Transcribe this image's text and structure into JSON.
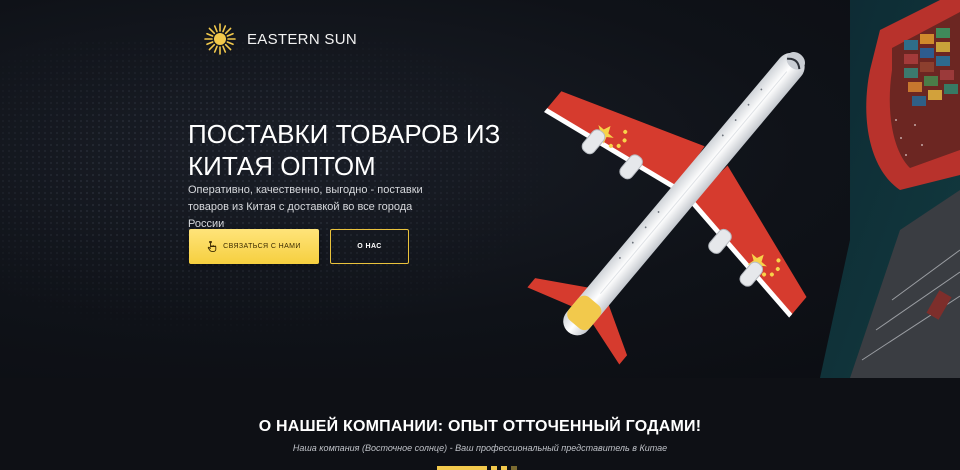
{
  "brand": {
    "name": "EASTERN SUN",
    "logo_icon": "sun-icon",
    "accent": "#f2c94c"
  },
  "hero": {
    "title_line1": "ПОСТАВКИ ТОВАРОВ ИЗ",
    "title_line2": "КИТАЯ ОПТОМ",
    "subtitle_line1": "Оперативно, качественно, выгодно - поставки",
    "subtitle_line2": "товаров из Китая с доставкой во все города России",
    "primary_button": {
      "label": "СВЯЗАТЬСЯ С НАМИ",
      "icon": "pointer-hand-icon",
      "color": "#f6cf3f"
    },
    "secondary_button": {
      "label": "О НАС"
    },
    "background_color": "#0f1218"
  },
  "about": {
    "title": "О НАШЕЙ КОМПАНИИ: ОПЫТ ОТТОЧЕННЫЙ ГОДАМИ!",
    "subtitle": "Наша компания (Восточное солнце) - Ваш профессиональный представитель в Китае"
  }
}
